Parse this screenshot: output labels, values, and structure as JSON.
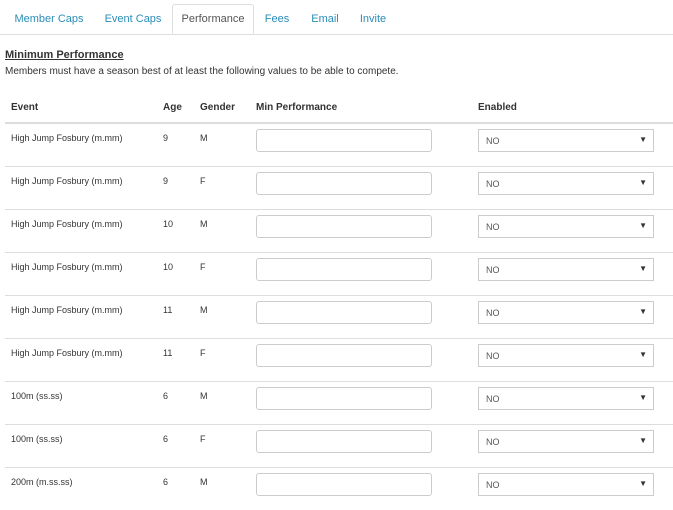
{
  "tabs": [
    {
      "label": "Member Caps"
    },
    {
      "label": "Event Caps"
    },
    {
      "label": "Performance"
    },
    {
      "label": "Fees"
    },
    {
      "label": "Email"
    },
    {
      "label": "Invite"
    }
  ],
  "active_tab": "Performance",
  "section": {
    "title": "Minimum Performance",
    "description": "Members must have a season best of at least the following values to be able to compete."
  },
  "table": {
    "columns": [
      "Event",
      "Age",
      "Gender",
      "Min Performance",
      "Enabled"
    ],
    "rows": [
      {
        "event": "High Jump Fosbury (m.mm)",
        "age": "9",
        "gender": "M",
        "min_performance": "",
        "enabled": "NO"
      },
      {
        "event": "High Jump Fosbury (m.mm)",
        "age": "9",
        "gender": "F",
        "min_performance": "",
        "enabled": "NO"
      },
      {
        "event": "High Jump Fosbury (m.mm)",
        "age": "10",
        "gender": "M",
        "min_performance": "",
        "enabled": "NO"
      },
      {
        "event": "High Jump Fosbury (m.mm)",
        "age": "10",
        "gender": "F",
        "min_performance": "",
        "enabled": "NO"
      },
      {
        "event": "High Jump Fosbury (m.mm)",
        "age": "11",
        "gender": "M",
        "min_performance": "",
        "enabled": "NO"
      },
      {
        "event": "High Jump Fosbury (m.mm)",
        "age": "11",
        "gender": "F",
        "min_performance": "",
        "enabled": "NO"
      },
      {
        "event": "100m (ss.ss)",
        "age": "6",
        "gender": "M",
        "min_performance": "",
        "enabled": "NO"
      },
      {
        "event": "100m (ss.ss)",
        "age": "6",
        "gender": "F",
        "min_performance": "",
        "enabled": "NO"
      },
      {
        "event": "200m (m.ss.ss)",
        "age": "6",
        "gender": "M",
        "min_performance": "",
        "enabled": "NO"
      }
    ]
  },
  "icons": {
    "select_caret": "caret-down-icon"
  }
}
